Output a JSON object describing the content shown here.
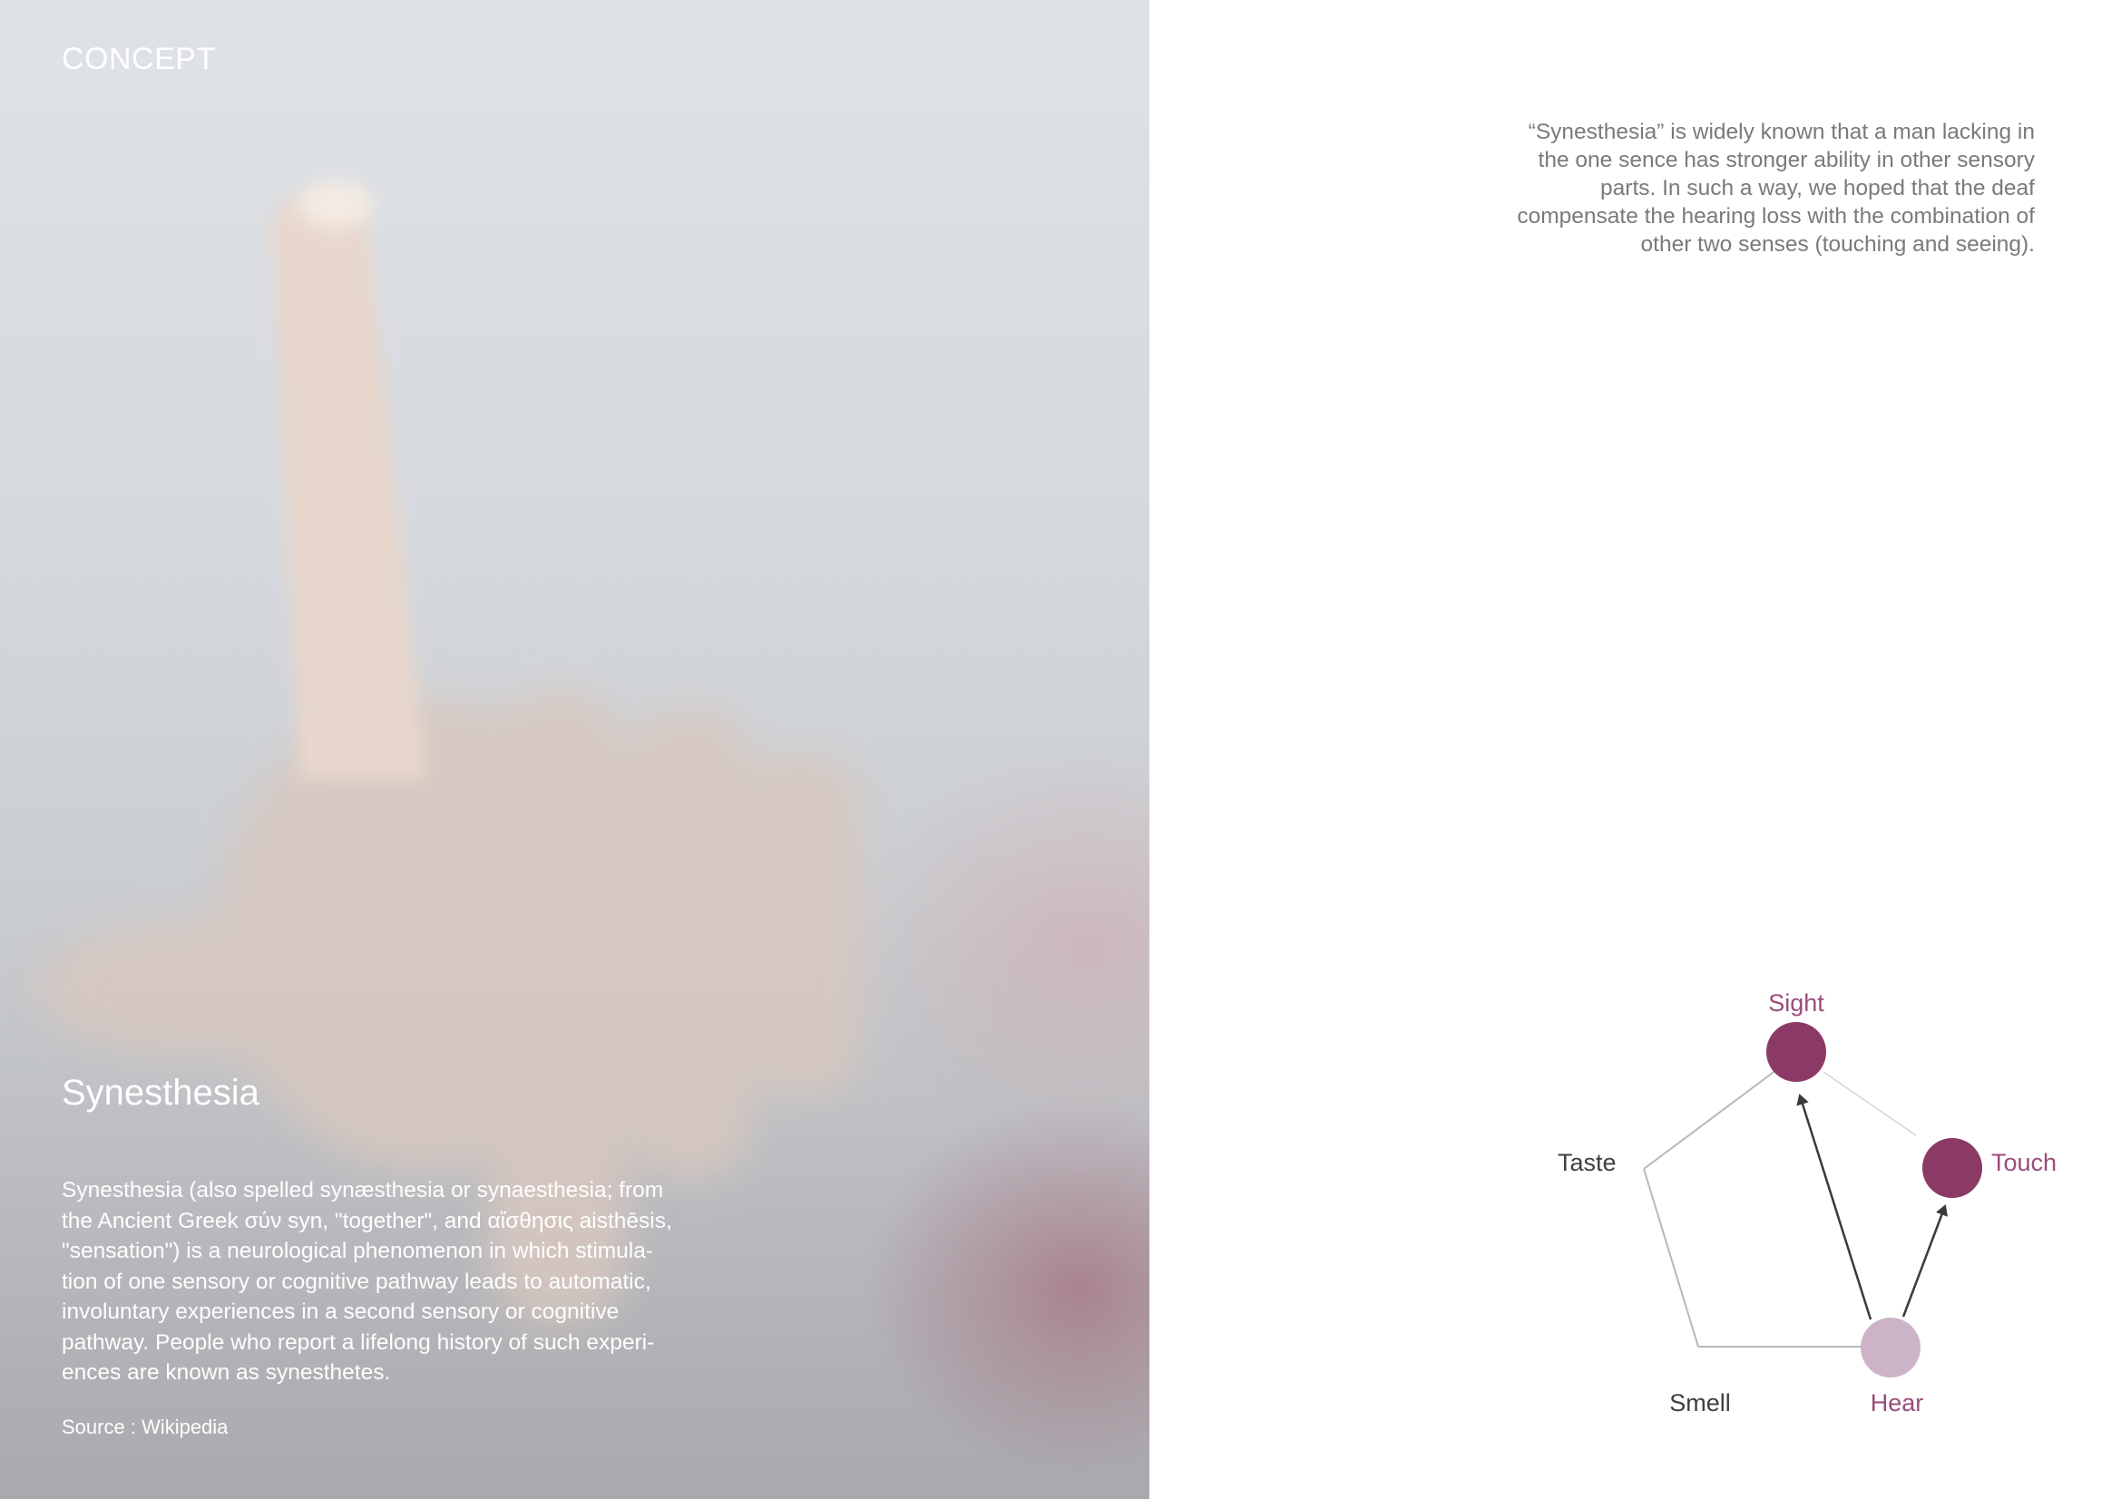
{
  "page": {
    "section_heading": "CONCEPT",
    "title": "Synesthesia",
    "body_lines": [
      "Synesthesia (also spelled synæsthesia or synaesthesia; from",
      "the Ancient Greek σύν syn, \"together\", and αἴσθησις aisthēsis,",
      "\"sensation\") is a neurological phenomenon in which stimula-",
      "tion of one sensory or cognitive pathway leads to automatic,",
      "involuntary experiences in a second sensory or cognitive",
      "pathway. People who report a lifelong history of such experi-",
      "ences are known as synesthetes."
    ],
    "source": "Source : Wikipedia",
    "quote_lines": [
      "“Synesthesia” is widely known that a man lacking in",
      "the one sence has stronger ability in other sensory",
      "parts. In such a way, we hoped that the deaf",
      "compensate the hearing loss with the combination of",
      "other two senses (touching and seeing)."
    ]
  },
  "diagram": {
    "nodes": {
      "sight": {
        "label": "Sight",
        "color": "#8b3a66"
      },
      "touch": {
        "label": "Touch",
        "color": "#8b3a66"
      },
      "hear": {
        "label": "Hear",
        "color": "#cdb3c8"
      },
      "smell": {
        "label": "Smell",
        "color": "#4a4a4a"
      },
      "taste": {
        "label": "Taste",
        "color": "#4a4a4a"
      }
    },
    "active_label_color": "#9a4d7a",
    "inactive_label_color": "#3f3f3f",
    "edge_color": "#b8b8b8",
    "arrow_color": "#3a3a3a"
  }
}
